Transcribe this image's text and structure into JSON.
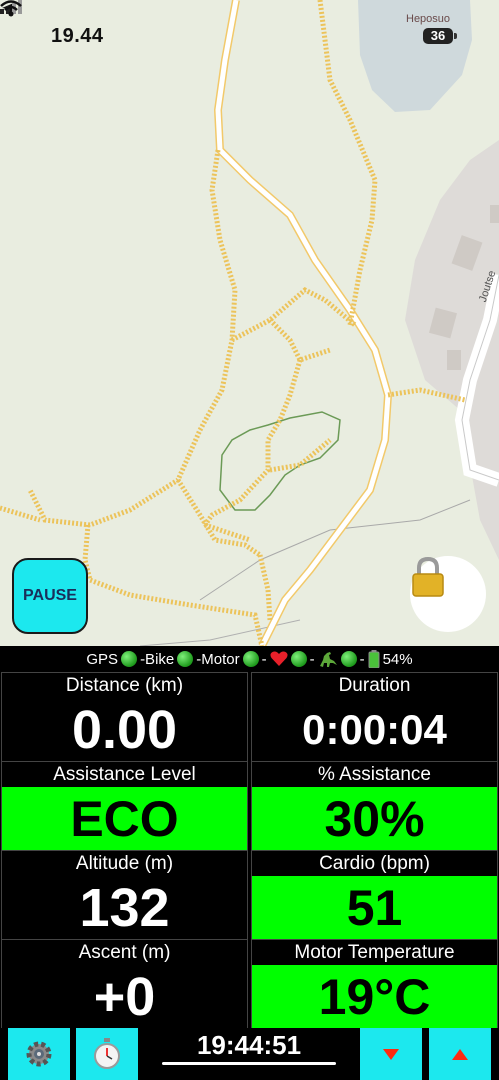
{
  "status": {
    "time": "19.44",
    "battery": "36"
  },
  "map": {
    "place_label": "Heposuo",
    "road_label": "Joutse"
  },
  "controls": {
    "pause_label": "PAUSE"
  },
  "sensors": {
    "gps": "GPS",
    "bike": "-Bike",
    "motor": "-Motor",
    "sep": "-",
    "battery_pct": "54%"
  },
  "metrics": {
    "distance": {
      "label": "Distance (km)",
      "value": "0.00"
    },
    "duration": {
      "label": "Duration",
      "value": "0:00:04"
    },
    "assist_level": {
      "label": "Assistance Level",
      "value": "ECO"
    },
    "assist_pct": {
      "label": "% Assistance",
      "value": "30%"
    },
    "altitude": {
      "label": "Altitude (m)",
      "value": "132"
    },
    "cardio": {
      "label": "Cardio (bpm)",
      "value": "51"
    },
    "ascent": {
      "label": "Ascent (m)",
      "value": "+0"
    },
    "motor_temp": {
      "label": "Motor Temperature",
      "value": "19°C"
    }
  },
  "bottom": {
    "clock": "19:44:51"
  },
  "colors": {
    "accent_cyan": "#1ce8ee",
    "value_green": "#00ff00",
    "arrow_red": "#ff2a10"
  }
}
